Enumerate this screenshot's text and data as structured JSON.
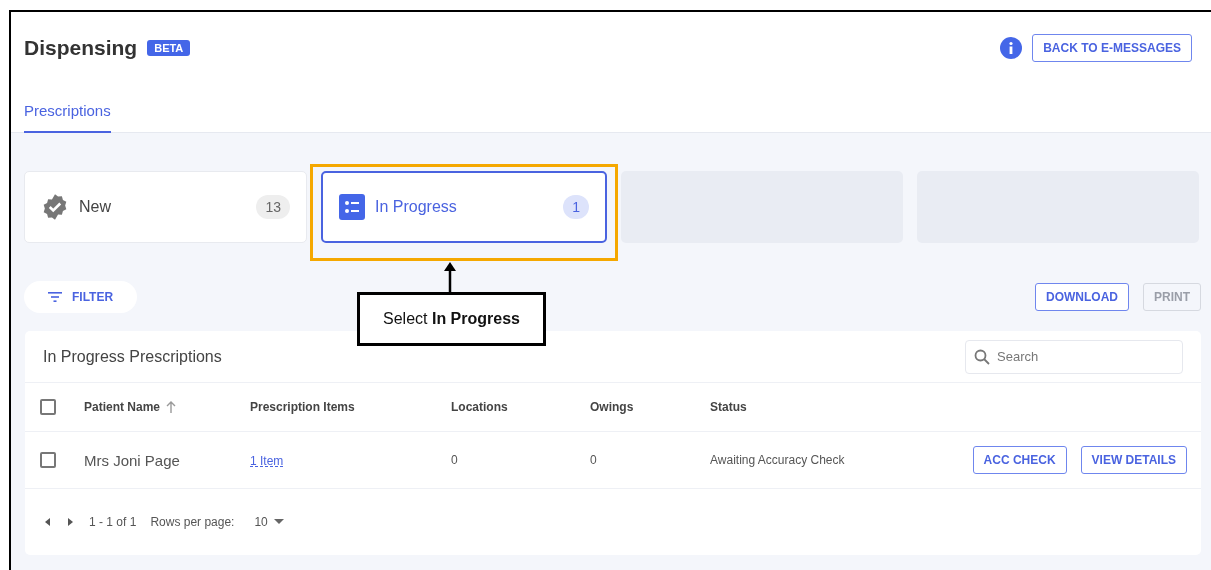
{
  "header": {
    "title": "Dispensing",
    "badge": "BETA",
    "back_button": "BACK TO E-MESSAGES"
  },
  "tabs": [
    {
      "label": "Prescriptions",
      "selected": true
    }
  ],
  "status_cards": [
    {
      "kind": "new",
      "label": "New",
      "count": "13",
      "selected": false
    },
    {
      "kind": "in_progress",
      "label": "In Progress",
      "count": "1",
      "selected": true
    },
    {
      "kind": "placeholder"
    },
    {
      "kind": "placeholder"
    }
  ],
  "annotation": {
    "text": "Select **In Progress**"
  },
  "toolbar": {
    "filter": "FILTER",
    "download": "DOWNLOAD",
    "print": {
      "label": "PRINT",
      "disabled": true
    }
  },
  "table": {
    "title": "In Progress Prescriptions",
    "search": {
      "placeholder": "Search"
    },
    "select_all_checked": false,
    "columns": [
      {
        "label": "Patient Name",
        "sorted": true
      },
      {
        "label": "Prescription Items",
        "sorted": false
      },
      {
        "label": "Locations",
        "sorted": false
      },
      {
        "label": "Owings",
        "sorted": false
      },
      {
        "label": "Status",
        "sorted": false
      }
    ],
    "rows": [
      {
        "checked": false,
        "patient": "Mrs Joni Page",
        "items": "1 Item",
        "locations": "0",
        "owings": "0",
        "status": "Awaiting Accuracy Check",
        "actions": [
          "ACC CHECK",
          "VIEW DETAILS"
        ]
      }
    ],
    "pagination": {
      "range": "1 - 1 of 1",
      "rows_per_page_label": "Rows per page:",
      "rows_per_page": "10"
    }
  }
}
